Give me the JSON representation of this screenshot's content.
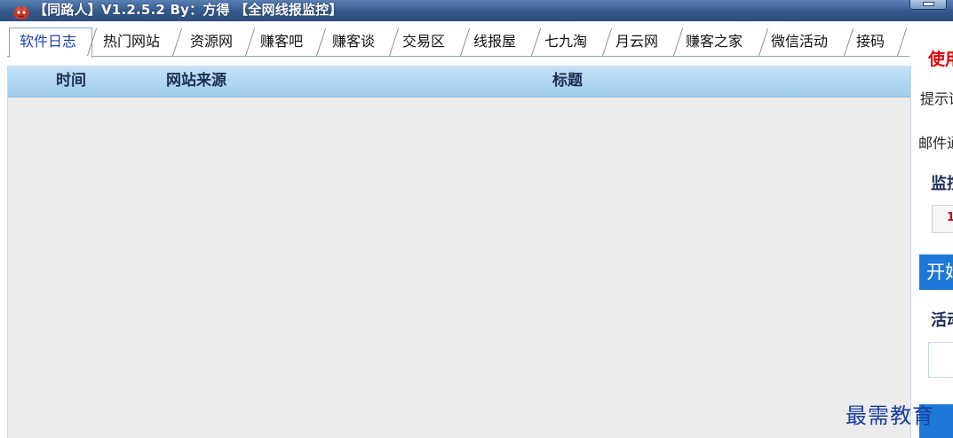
{
  "window": {
    "title": "【同路人】V1.2.5.2  By：方得  【全网线报监控】"
  },
  "tabs": [
    {
      "label": "软件日志",
      "active": true
    },
    {
      "label": "热门网站"
    },
    {
      "label": "资源网"
    },
    {
      "label": "赚客吧"
    },
    {
      "label": "赚客谈"
    },
    {
      "label": "交易区"
    },
    {
      "label": "线报屋"
    },
    {
      "label": "七九淘"
    },
    {
      "label": "月云网"
    },
    {
      "label": "赚客之家"
    },
    {
      "label": "微信活动"
    },
    {
      "label": "接码"
    }
  ],
  "list": {
    "columns": [
      "时间",
      "网站来源",
      "标题"
    ],
    "rows": []
  },
  "right_panel": {
    "header_red": "使用",
    "hint_label": "提示语",
    "mail_label": "邮件通",
    "monitor_label": "监控",
    "interval_value": "1",
    "start_button": "开始",
    "activity_label": "活动"
  },
  "watermark": "最需教育",
  "colors": {
    "titlebar": "#35598c",
    "header": "#aed5f2",
    "list_bg": "#ececec",
    "accent_blue": "#1e78d8",
    "red": "#e00000"
  }
}
